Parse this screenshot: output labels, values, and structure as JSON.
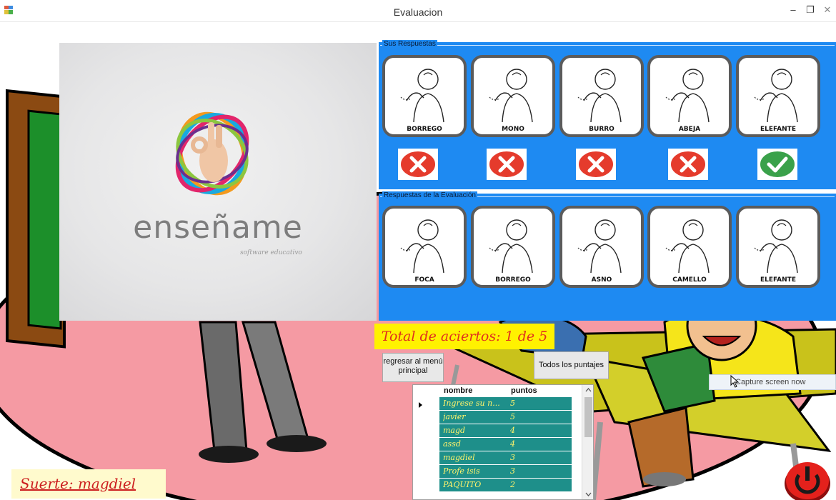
{
  "window": {
    "title": "Evaluacion",
    "minimize_glyph": "–",
    "restore_glyph": "❐",
    "close_glyph": "✕"
  },
  "colors": {
    "panel_blue": "#1e8af2",
    "grid_row": "#1e8f8a",
    "grid_text": "#fff36b",
    "banner_yellow": "#fff200",
    "banner_text": "#e0301e",
    "wrong_red": "#e53b2c",
    "right_green": "#3aa14a"
  },
  "splash": {
    "brand": "enseñame",
    "tagline": "software educativo"
  },
  "sus_respuestas": {
    "legend": "Sus Respuestas",
    "cards": [
      {
        "label": "BORREGO",
        "result": "wrong"
      },
      {
        "label": "MONO",
        "result": "wrong"
      },
      {
        "label": "BURRO",
        "result": "wrong"
      },
      {
        "label": "ABEJA",
        "result": "wrong"
      },
      {
        "label": "ELEFANTE",
        "result": "correct"
      }
    ]
  },
  "respuestas_evaluacion": {
    "legend": "Respuestas de la Evaluación",
    "cards": [
      {
        "label": "FOCA"
      },
      {
        "label": "BORREGO"
      },
      {
        "label": "ASNO"
      },
      {
        "label": "CAMELLO"
      },
      {
        "label": "ELEFANTE"
      }
    ]
  },
  "total_aciertos": "Total de aciertos: 1 de 5",
  "buttons": {
    "menu_label": "regresar al menú principal",
    "scores_label": "Todos los puntajes"
  },
  "tooltip": "Capture screen now",
  "scores_grid": {
    "headers": [
      "nombre",
      "puntos"
    ],
    "rows": [
      {
        "nombre": "Ingrese su n...",
        "puntos": "5"
      },
      {
        "nombre": "javier",
        "puntos": "5"
      },
      {
        "nombre": "magd",
        "puntos": "4"
      },
      {
        "nombre": "assd",
        "puntos": "4"
      },
      {
        "nombre": "magdiel",
        "puntos": "3"
      },
      {
        "nombre": "Profe isis",
        "puntos": "3"
      },
      {
        "nombre": "PAQUITO",
        "puntos": "2"
      }
    ]
  },
  "suerte": "Suerte: magdiel"
}
